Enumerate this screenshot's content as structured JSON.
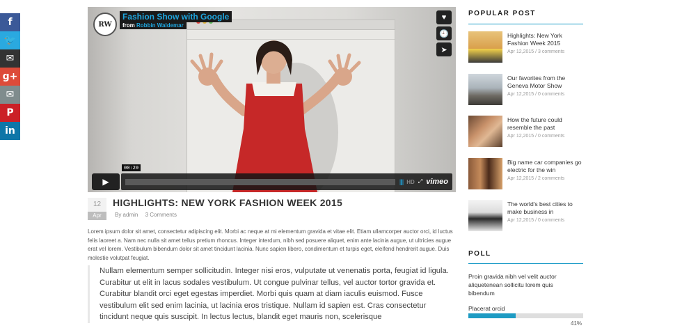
{
  "share": {
    "items": [
      {
        "name": "facebook",
        "glyph": "f",
        "color": "#3b5998"
      },
      {
        "name": "twitter",
        "glyph": "🐦",
        "color": "#2aa9e0"
      },
      {
        "name": "gmail",
        "glyph": "✉",
        "color": "#333333"
      },
      {
        "name": "google-plus",
        "glyph": "g+",
        "color": "#dd4b39"
      },
      {
        "name": "email",
        "glyph": "✉",
        "color": "#7f8c8d"
      },
      {
        "name": "pinterest",
        "glyph": "P",
        "color": "#cb2027"
      },
      {
        "name": "linkedin",
        "glyph": "in",
        "color": "#0e76a8"
      }
    ]
  },
  "video": {
    "title": "Fashion Show with Google",
    "from_label": "from",
    "author": "Robbin Waldemar",
    "logo_text": "RW",
    "time": "00:20",
    "hd_label": "HD",
    "brand": "vimeo"
  },
  "post": {
    "day": "12",
    "month": "Apr",
    "title": "HIGHLIGHTS: NEW YORK FASHION WEEK 2015",
    "author": "By admin",
    "comments": "3 Comments",
    "body": "Lorem ipsum dolor sit amet, consectetur adipiscing elit. Morbi ac neque at mi elementum gravida et vitae elit. Etiam ullamcorper auctor orci, id luctus felis laoreet a. Nam nec nulla sit amet tellus pretium rhoncus. Integer interdum, nibh sed posuere aliquet, enim ante lacinia augue, ut ultricies augue erat vel lorem. Vestibulum bibendum dolor sit amet tincidunt lacinia. Nunc sapien libero, condimentum et turpis eget, eleifend hendrerit augue. Duis molestie volutpat feugiat.",
    "quote": "Nullam elementum semper sollicitudin. Integer nisi eros, vulputate ut venenatis porta, feugiat id ligula. Curabitur ut elit in lacus sodales vestibulum. Ut congue pulvinar tellus, vel auctor tortor gravida et. Curabitur blandit orci eget egestas imperdiet. Morbi quis quam at diam iaculis euismod. Fusce vestibulum elit sed enim lacinia, ut lacinia eros tristique. Nullam id sapien est. Cras consectetur tincidunt neque quis suscipit. In lectus lectus, blandit eget mauris non, scelerisque"
  },
  "sidebar": {
    "popular_heading": "POPULAR POST",
    "popular": [
      {
        "title": "Highlights: New York Fashion Week 2015",
        "date": "Apr 12,2015",
        "comments": "3 comments"
      },
      {
        "title": "Our favorites from the Geneva Motor Show",
        "date": "Apr 12,2015",
        "comments": "0 comments"
      },
      {
        "title": "How the future could resemble the past",
        "date": "Apr 12,2015",
        "comments": "0 comments"
      },
      {
        "title": "Big name car companies go electric for the win",
        "date": "Apr 12,2015",
        "comments": "2 comments"
      },
      {
        "title": "The world's best cities to make business in",
        "date": "Apr 12,2015",
        "comments": "0 comments"
      }
    ],
    "poll_heading": "POLL",
    "poll_question": "Proin gravida nibh vel velit auctor aliquetenean sollicitu lorem quis bibendum",
    "poll_option": "Placerat orcid",
    "poll_percent": "41%",
    "poll_value": 0.41,
    "accent": "#1e9bc3"
  }
}
